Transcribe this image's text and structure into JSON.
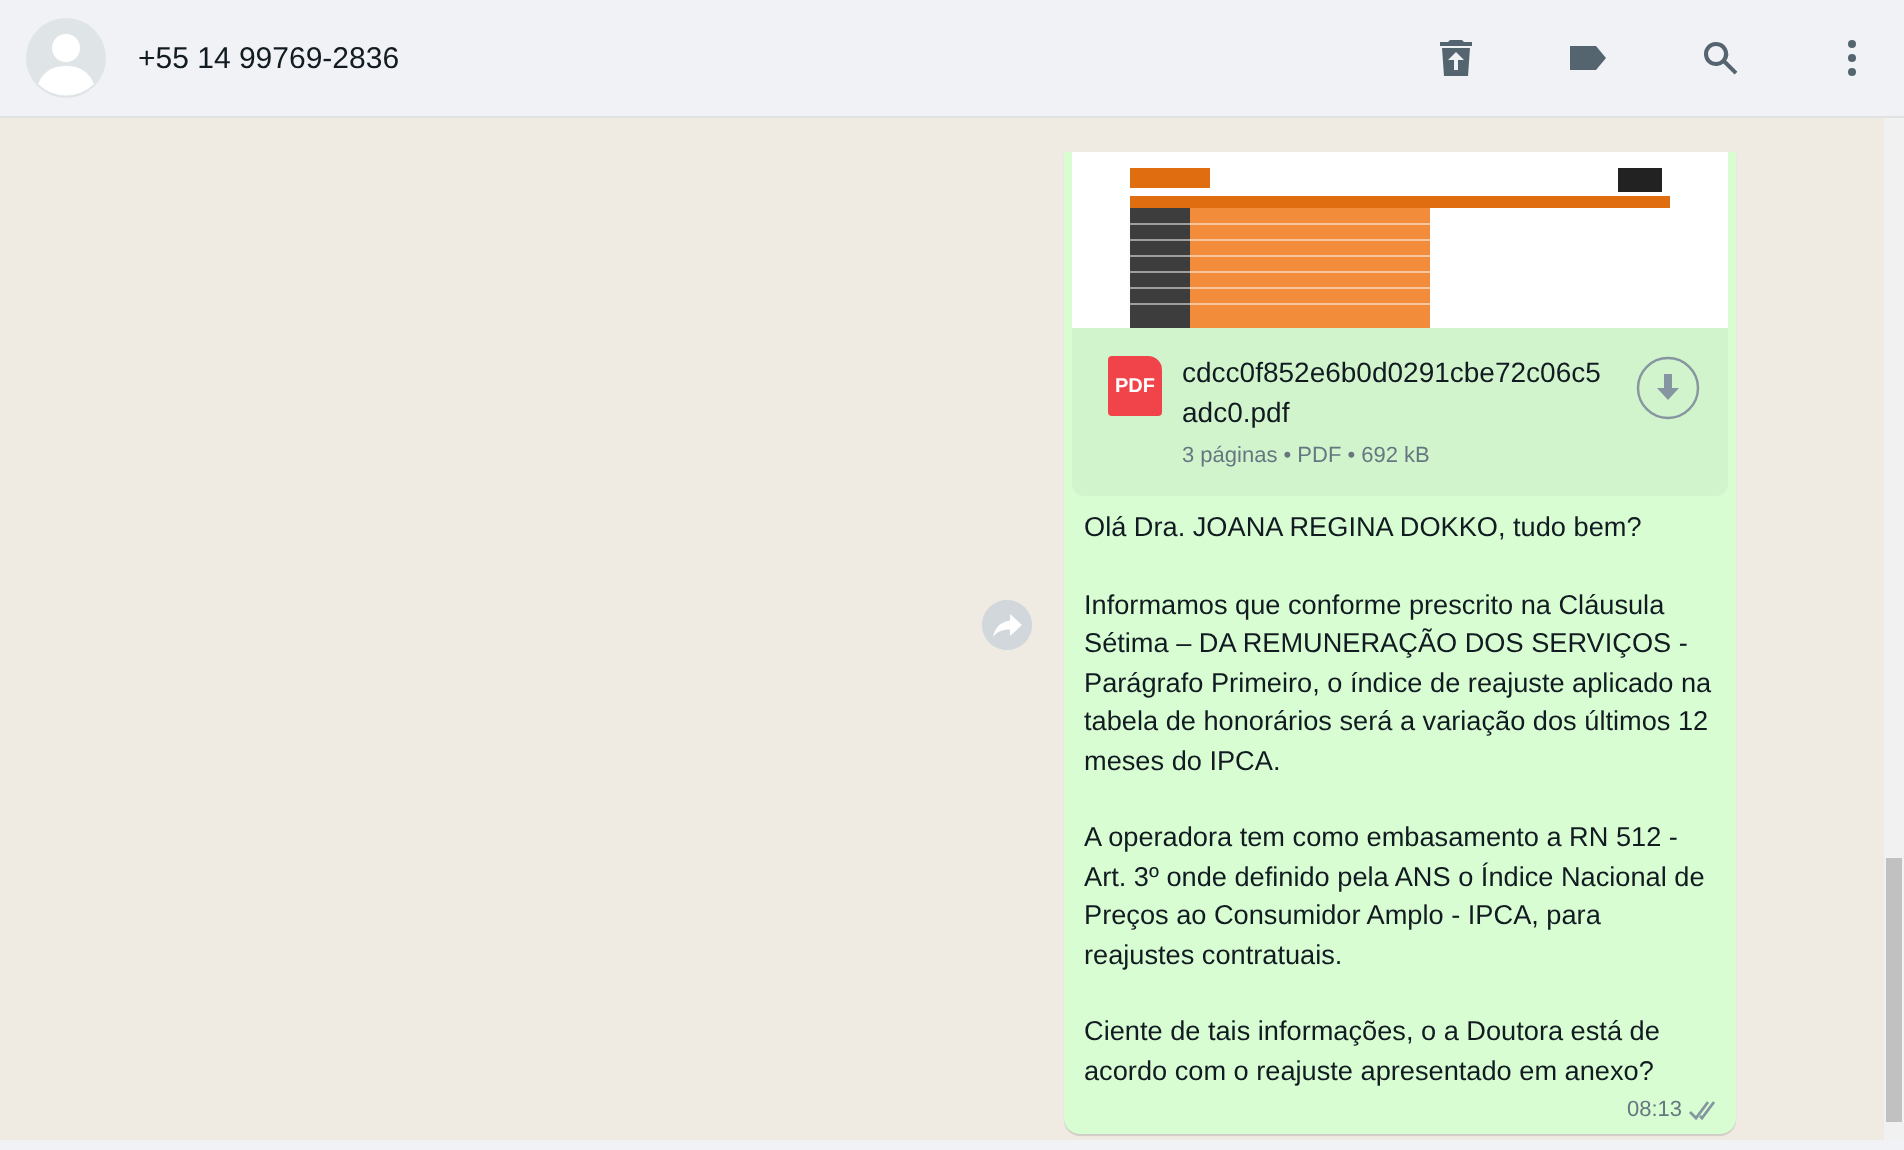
{
  "header": {
    "contact": "+55 14 99769-2836"
  },
  "message": {
    "document": {
      "filename": "cdcc0f852e6b0d0291cbe72c06c5adc0.pdf",
      "type_label": "PDF",
      "details": "3 páginas • PDF • 692 kB"
    },
    "paragraphs": [
      "Olá Dra. JOANA REGINA DOKKO, tudo bem?",
      "Informamos que conforme prescrito na Cláusula Sétima – DA REMUNERAÇÃO DOS SERVIÇOS - Parágrafo Primeiro, o índice de reajuste aplicado na tabela de honorários será a variação dos últimos 12 meses do IPCA.",
      "A operadora tem como embasamento a RN 512 - Art. 3º onde definido pela ANS o Índice Nacional de Preços ao Consumidor Amplo - IPCA, para reajustes contratuais.",
      "Ciente de tais informações, o a Doutora está de acordo com o reajuste apresentado em anexo?"
    ],
    "time": "08:13",
    "read": false
  }
}
